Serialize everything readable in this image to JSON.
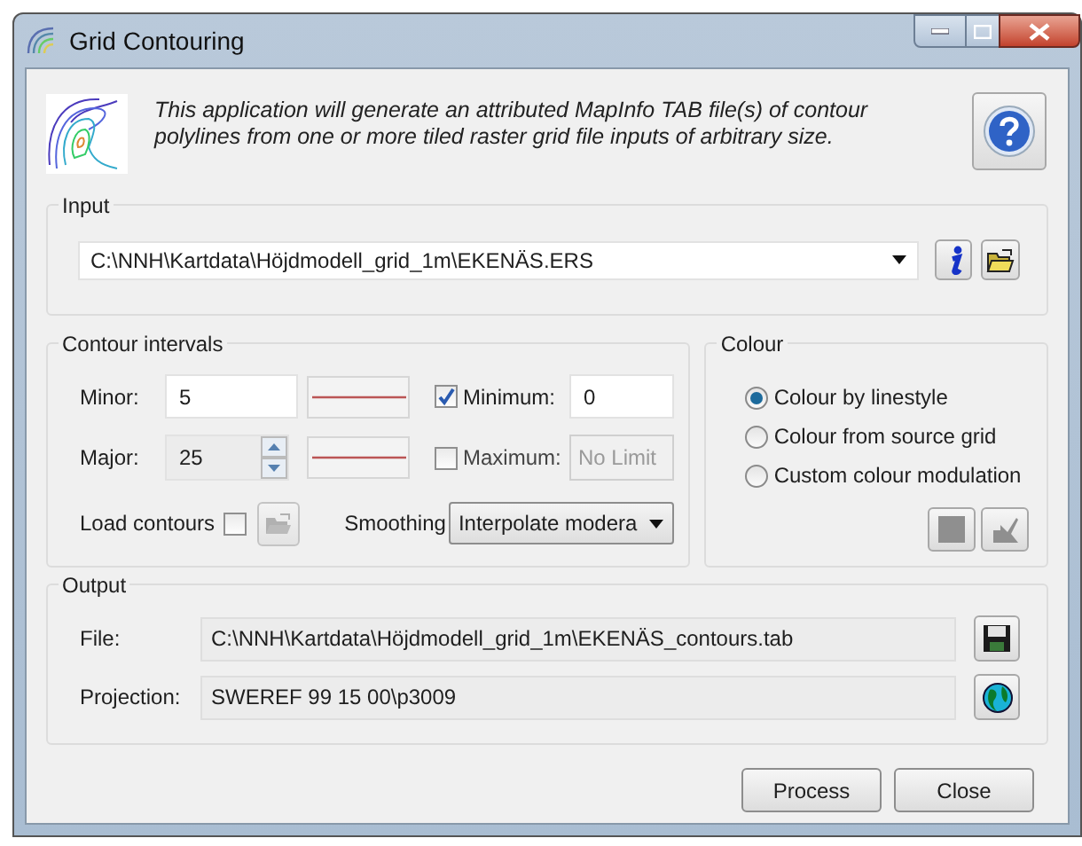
{
  "window": {
    "title": "Grid Contouring"
  },
  "description": "This application will generate an attributed MapInfo TAB file(s) of contour polylines from one or more tiled raster grid file inputs of arbitrary size.",
  "input": {
    "label": "Input",
    "path": "C:\\NNH\\Kartdata\\Höjdmodell_grid_1m\\EKENÄS.ERS"
  },
  "contour_intervals": {
    "label": "Contour intervals",
    "minor": {
      "label": "Minor:",
      "value": "5"
    },
    "major": {
      "label": "Major:",
      "value": "25"
    },
    "minimum": {
      "label": "Minimum:",
      "checked": true,
      "value": "0"
    },
    "maximum": {
      "label": "Maximum:",
      "checked": false,
      "placeholder": "No Limit"
    },
    "load_contours": {
      "label": "Load contours",
      "checked": false
    },
    "smoothing": {
      "label": "Smoothing",
      "value": "Interpolate modera"
    }
  },
  "colour": {
    "label": "Colour",
    "options": [
      {
        "label": "Colour by linestyle",
        "selected": true
      },
      {
        "label": "Colour from source grid",
        "selected": false
      },
      {
        "label": "Custom colour modulation",
        "selected": false
      }
    ]
  },
  "output": {
    "label": "Output",
    "file": {
      "label": "File:",
      "value": "C:\\NNH\\Kartdata\\Höjdmodell_grid_1m\\EKENÄS_contours.tab"
    },
    "projection": {
      "label": "Projection:",
      "value": "SWEREF 99 15 00\\p3009"
    }
  },
  "buttons": [
    {
      "label": "Process"
    },
    {
      "label": "Close"
    }
  ]
}
